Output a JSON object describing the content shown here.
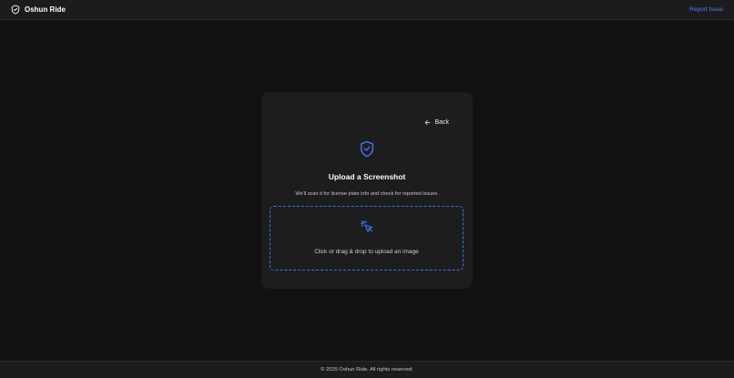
{
  "header": {
    "brand_icon": "shield-icon",
    "brand_name": "Oshun Ride",
    "report_link": "Report Issue"
  },
  "card": {
    "back_label": "Back",
    "back_icon": "arrow-left-icon",
    "shield_icon": "shield-check-icon",
    "title": "Upload a Screenshot",
    "subtitle": "We'll scan it for license plate info and check for reported issues.",
    "dropzone": {
      "icon": "cursor-click-icon",
      "text": "Click or drag & drop to upload an image"
    }
  },
  "footer": {
    "copyright": "© 2025 Oshun Ride. All rights reserved."
  },
  "colors": {
    "background": "#111112",
    "surface": "#1d1d1f",
    "accent": "#3f6fe0",
    "link": "#5b7cf5"
  }
}
